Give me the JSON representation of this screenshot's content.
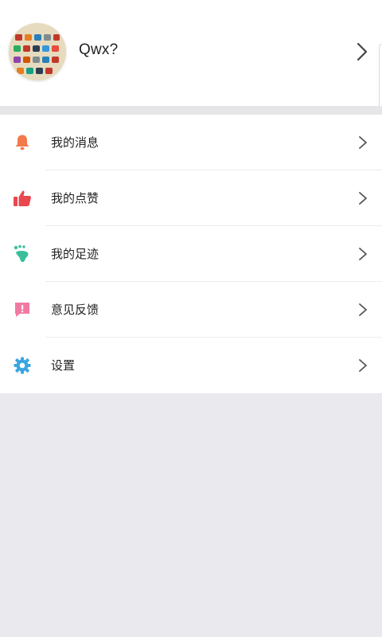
{
  "profile": {
    "name": "Qwx?"
  },
  "menu": {
    "items": [
      {
        "label": "我的消息",
        "icon": "bell-icon",
        "color": "#f27a4a"
      },
      {
        "label": "我的点赞",
        "icon": "thumbs-up-icon",
        "color": "#e8484e"
      },
      {
        "label": "我的足迹",
        "icon": "footprint-icon",
        "color": "#3bbf9b"
      },
      {
        "label": "意见反馈",
        "icon": "feedback-icon",
        "color": "#f27aa2"
      },
      {
        "label": "设置",
        "icon": "gear-icon",
        "color": "#3aa6e0"
      }
    ]
  },
  "colors": {
    "background": "#e9e9ee",
    "surface": "#ffffff",
    "text": "#222222",
    "chevron": "#555555"
  }
}
